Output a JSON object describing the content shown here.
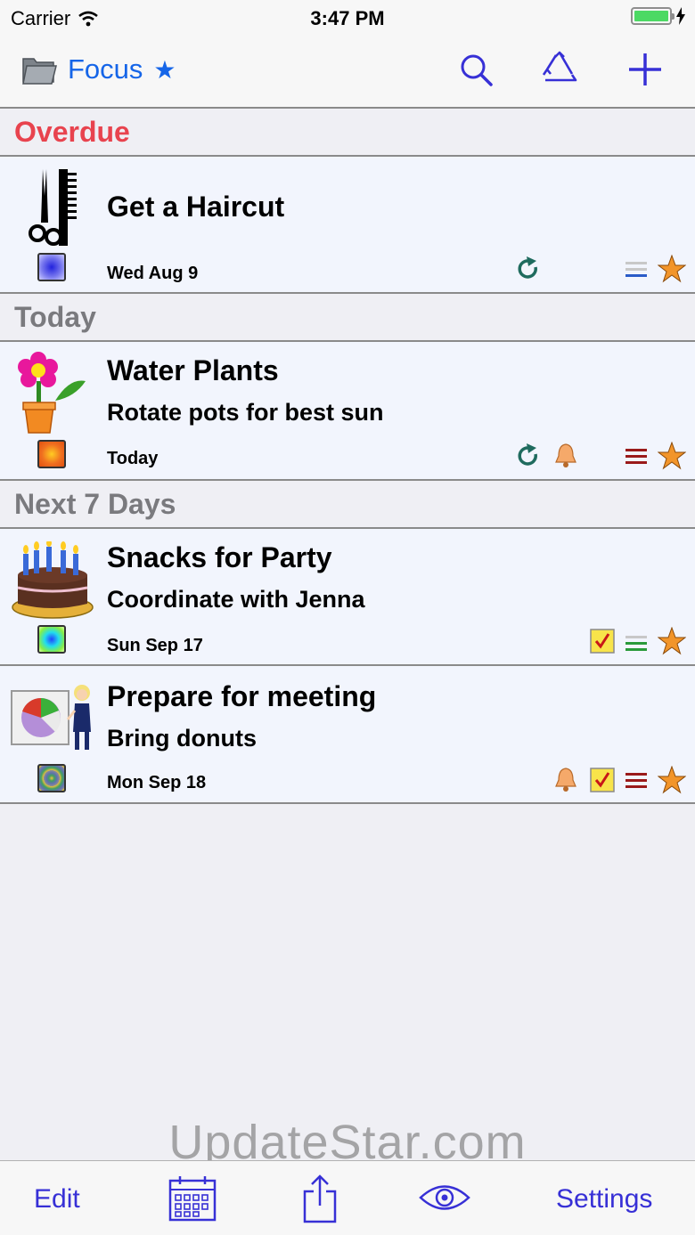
{
  "status_bar": {
    "carrier": "Carrier",
    "time": "3:47 PM"
  },
  "nav": {
    "title": "Focus",
    "star": "★",
    "accent": "#1565e8",
    "icons": [
      "folder-icon",
      "search-icon",
      "recycle-icon",
      "plus-icon"
    ]
  },
  "sections": {
    "overdue": "Overdue",
    "today": "Today",
    "next7": "Next 7 Days"
  },
  "tasks": [
    {
      "title": "Get a Haircut",
      "note": "",
      "date": "Wed Aug 9",
      "icon": "scissors-comb-icon",
      "indicators": [
        "repeat-icon",
        "priority-low-icon",
        "star-icon"
      ]
    },
    {
      "title": "Water Plants",
      "note": "Rotate pots for best sun",
      "date": "Today",
      "icon": "flower-pot-icon",
      "indicators": [
        "repeat-icon",
        "bell-icon",
        "priority-high-icon",
        "star-icon"
      ]
    },
    {
      "title": "Snacks for Party",
      "note": "Coordinate with Jenna",
      "date": "Sun Sep 17",
      "icon": "birthday-cake-icon",
      "indicators": [
        "checkbox-icon",
        "priority-medium-icon",
        "star-icon"
      ]
    },
    {
      "title": "Prepare for meeting",
      "note": "Bring donuts",
      "date": "Mon Sep 18",
      "icon": "presentation-icon",
      "indicators": [
        "bell-icon",
        "checkbox-icon",
        "priority-high-icon",
        "star-icon"
      ]
    }
  ],
  "watermark": "UpdateStar.com",
  "tabbar": {
    "edit": "Edit",
    "settings": "Settings",
    "accent": "#3730d6"
  }
}
